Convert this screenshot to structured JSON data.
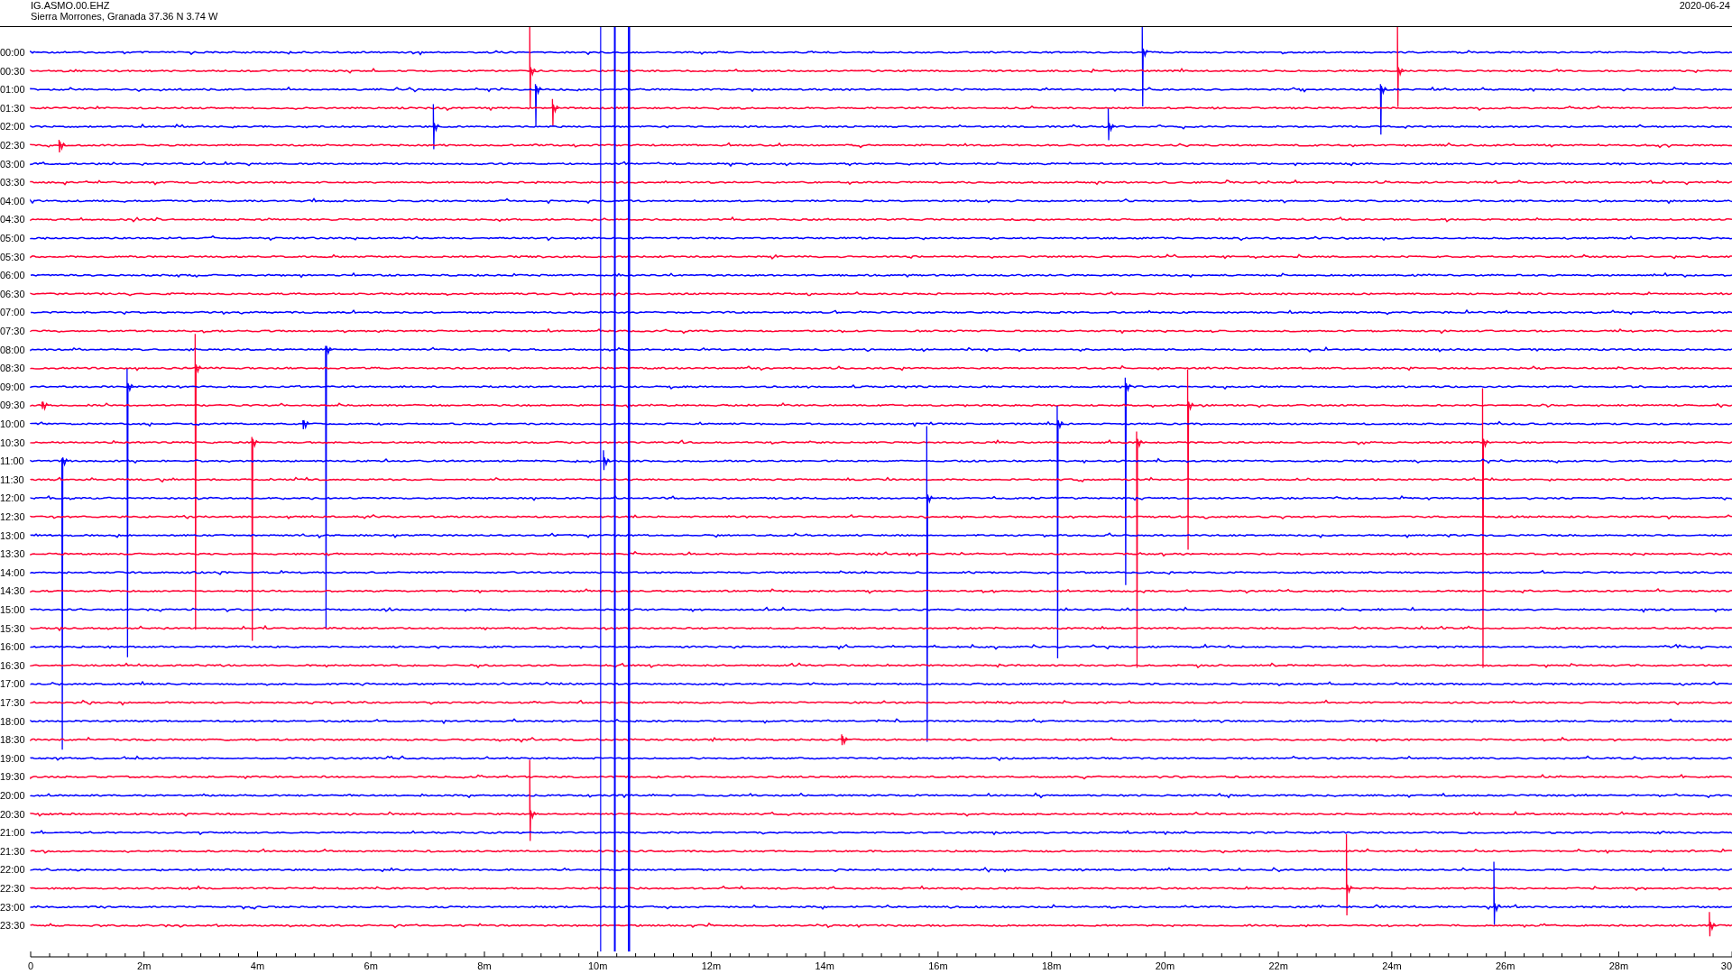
{
  "header": {
    "station": "IG.ASMO.00.EHZ",
    "location": "Sierra Morrones, Granada  37.36 N 3.74 W",
    "date": "2020-06-24"
  },
  "rows": [
    {
      "time": "00:00",
      "color": "#0000ff"
    },
    {
      "time": "00:30",
      "color": "#ff0033"
    },
    {
      "time": "01:00",
      "color": "#0000ff"
    },
    {
      "time": "01:30",
      "color": "#ff0033"
    },
    {
      "time": "02:00",
      "color": "#0000ff"
    },
    {
      "time": "02:30",
      "color": "#ff0033"
    },
    {
      "time": "03:00",
      "color": "#0000ff"
    },
    {
      "time": "03:30",
      "color": "#ff0033"
    },
    {
      "time": "04:00",
      "color": "#0000ff"
    },
    {
      "time": "04:30",
      "color": "#ff0033"
    },
    {
      "time": "05:00",
      "color": "#0000ff"
    },
    {
      "time": "05:30",
      "color": "#ff0033"
    },
    {
      "time": "06:00",
      "color": "#0000ff"
    },
    {
      "time": "06:30",
      "color": "#ff0033"
    },
    {
      "time": "07:00",
      "color": "#0000ff"
    },
    {
      "time": "07:30",
      "color": "#ff0033"
    },
    {
      "time": "08:00",
      "color": "#0000ff"
    },
    {
      "time": "08:30",
      "color": "#ff0033"
    },
    {
      "time": "09:00",
      "color": "#0000ff"
    },
    {
      "time": "09:30",
      "color": "#ff0033"
    },
    {
      "time": "10:00",
      "color": "#0000ff"
    },
    {
      "time": "10:30",
      "color": "#ff0033"
    },
    {
      "time": "11:00",
      "color": "#0000ff"
    },
    {
      "time": "11:30",
      "color": "#ff0033"
    },
    {
      "time": "12:00",
      "color": "#0000ff"
    },
    {
      "time": "12:30",
      "color": "#ff0033"
    },
    {
      "time": "13:00",
      "color": "#0000ff"
    },
    {
      "time": "13:30",
      "color": "#ff0033"
    },
    {
      "time": "14:00",
      "color": "#0000ff"
    },
    {
      "time": "14:30",
      "color": "#ff0033"
    },
    {
      "time": "15:00",
      "color": "#0000ff"
    },
    {
      "time": "15:30",
      "color": "#ff0033"
    },
    {
      "time": "16:00",
      "color": "#0000ff"
    },
    {
      "time": "16:30",
      "color": "#ff0033"
    },
    {
      "time": "17:00",
      "color": "#0000ff"
    },
    {
      "time": "17:30",
      "color": "#ff0033"
    },
    {
      "time": "18:00",
      "color": "#0000ff"
    },
    {
      "time": "18:30",
      "color": "#ff0033"
    },
    {
      "time": "19:00",
      "color": "#0000ff"
    },
    {
      "time": "19:30",
      "color": "#ff0033"
    },
    {
      "time": "20:00",
      "color": "#0000ff"
    },
    {
      "time": "20:30",
      "color": "#ff0033"
    },
    {
      "time": "21:00",
      "color": "#0000ff"
    },
    {
      "time": "21:30",
      "color": "#ff0033"
    },
    {
      "time": "22:00",
      "color": "#0000ff"
    },
    {
      "time": "22:30",
      "color": "#ff0033"
    },
    {
      "time": "23:00",
      "color": "#0000ff"
    },
    {
      "time": "23:30",
      "color": "#ff0033"
    }
  ],
  "axis": {
    "labels": [
      "0",
      "2m",
      "4m",
      "6m",
      "8m",
      "10m",
      "12m",
      "14m",
      "16m",
      "18m",
      "20m",
      "22m",
      "24m",
      "26m",
      "28m",
      "30"
    ]
  }
}
